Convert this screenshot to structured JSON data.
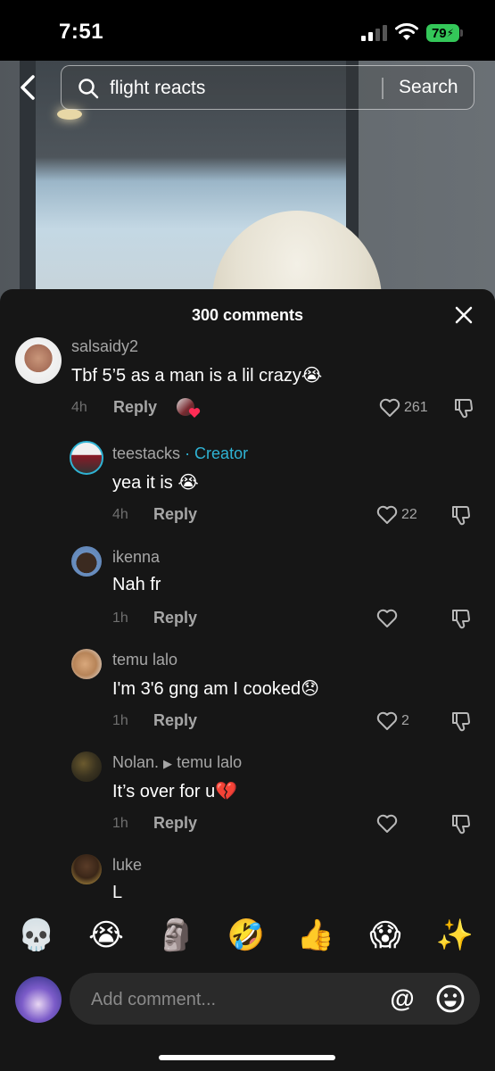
{
  "status_bar": {
    "time": "7:51",
    "battery": "79"
  },
  "search": {
    "query": "flight reacts",
    "button_label": "Search"
  },
  "comments_panel": {
    "title": "300 comments",
    "reply_label": "Reply",
    "comments": [
      {
        "username": "salsaidy2",
        "text": "Tbf 5’5 as a man is a lil crazy😭",
        "time": "4h",
        "likes": "261",
        "liked_by_creator": true
      },
      {
        "username": "teestacks",
        "creator_label": "· Creator",
        "text": "yea it is 😭",
        "time": "4h",
        "likes": "22"
      },
      {
        "username": "ikenna",
        "text": "Nah fr",
        "time": "1h",
        "likes": ""
      },
      {
        "username": "temu lalo",
        "text": "I'm 3'6 gng am I cooked😞",
        "time": "1h",
        "likes": "2"
      },
      {
        "username": "Nolan.",
        "reply_to": "temu lalo",
        "text": "It’s over for u💔",
        "time": "1h",
        "likes": ""
      },
      {
        "username": "luke",
        "text": "L"
      }
    ]
  },
  "emoji_bar": [
    "💀",
    "😭",
    "🗿",
    "🤣",
    "👍",
    "😱",
    "✨"
  ],
  "input": {
    "placeholder": "Add comment...",
    "mention_label": "@"
  },
  "colors": {
    "sheet_background": "#161616",
    "creator_accent": "#2fb3d4",
    "heart_badge": "#fe2c55",
    "battery": "#34c759"
  }
}
